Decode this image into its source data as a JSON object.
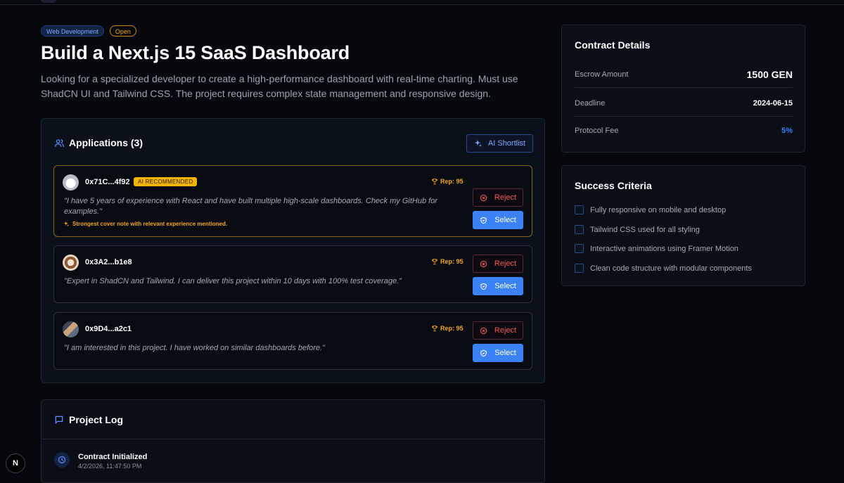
{
  "job": {
    "category_badge": "Web Development",
    "status_badge": "Open",
    "title": "Build a Next.js 15 SaaS Dashboard",
    "description": "Looking for a specialized developer to create a high-performance dashboard with real-time charting. Must use ShadCN UI and Tailwind CSS. The project requires complex state management and responsive design."
  },
  "applications": {
    "heading": "Applications (3)",
    "ai_shortlist_label": "AI Shortlist",
    "items": [
      {
        "address": "0x71C...4f92",
        "badge": "AI RECOMMENDED",
        "rep": "Rep: 95",
        "note": "\"I have 5 years of experience with React and have built multiple high-scale dashboards. Check my GitHub for examples.\"",
        "hint": "Strongest cover note with relevant experience mentioned.",
        "reject_label": "Reject",
        "select_label": "Select"
      },
      {
        "address": "0x3A2...b1e8",
        "rep": "Rep: 95",
        "note": "\"Expert in ShadCN and Tailwind. I can deliver this project within 10 days with 100% test coverage.\"",
        "reject_label": "Reject",
        "select_label": "Select"
      },
      {
        "address": "0x9D4...a2c1",
        "rep": "Rep: 95",
        "note": "\"I am interested in this project. I have worked on similar dashboards before.\"",
        "reject_label": "Reject",
        "select_label": "Select"
      }
    ]
  },
  "project_log": {
    "heading": "Project Log",
    "entries": [
      {
        "title": "Contract Initialized",
        "time": "4/2/2026, 11:47:50 PM"
      }
    ]
  },
  "contract": {
    "heading": "Contract Details",
    "escrow_label": "Escrow Amount",
    "escrow_value": "1500 GEN",
    "deadline_label": "Deadline",
    "deadline_value": "2024-06-15",
    "fee_label": "Protocol Fee",
    "fee_value": "5%"
  },
  "criteria": {
    "heading": "Success Criteria",
    "items": [
      "Fully responsive on mobile and desktop",
      "Tailwind CSS used for all styling",
      "Interactive animations using Framer Motion",
      "Clean code structure with modular components"
    ]
  },
  "dev_badge": "N",
  "colors": {
    "accent": "#3b82f6",
    "warning": "#f5a623",
    "danger": "#f05a5a",
    "background": "#06080d"
  }
}
